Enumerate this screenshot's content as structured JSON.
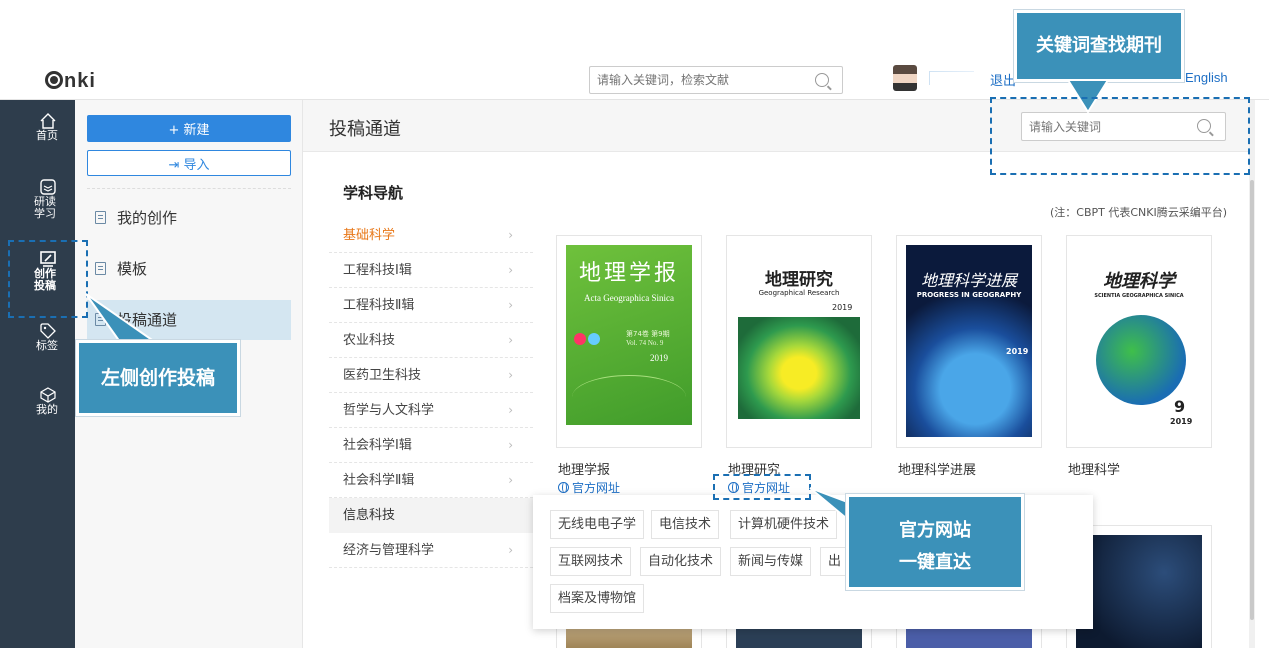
{
  "header": {
    "logo": "nki",
    "search_placeholder": "请输入关键词，检索文献",
    "logout": "退出",
    "language": "English"
  },
  "iconnav": [
    {
      "label": "首页",
      "icon": "home-icon"
    },
    {
      "label": "研读学习",
      "icon": "layers-icon"
    },
    {
      "label": "创作投稿",
      "icon": "edit-screen-icon"
    },
    {
      "label": "标签",
      "icon": "tag-icon"
    },
    {
      "label": "我的",
      "icon": "cube-icon"
    }
  ],
  "subside": {
    "new_button": "+ 新建",
    "import_button": "导入",
    "items": [
      "我的创作",
      "模板",
      "投稿通道"
    ]
  },
  "main": {
    "title": "投稿通道",
    "keyword_placeholder": "请输入关键词",
    "note": "(注：CBPT 代表CNKI腾云采编平台)",
    "nav_heading": "学科导航",
    "categories": [
      "基础科学",
      "工程科技Ⅰ辑",
      "工程科技Ⅱ辑",
      "农业科技",
      "医药卫生科技",
      "哲学与人文科学",
      "社会科学Ⅰ辑",
      "社会科学Ⅱ辑",
      "信息科技",
      "经济与管理科学"
    ],
    "journals": [
      {
        "name": "地理学报",
        "site": "官方网址",
        "cover_title": "地理学报",
        "cover_sub": "Acta Geographica Sinica",
        "cover_vol": "第74卷 第9期",
        "cover_vol2": "Vol. 74  No. 9",
        "cover_year": "2019"
      },
      {
        "name": "地理研究",
        "site": "官方网址",
        "cover_title": "地理研究",
        "cover_sub": "Geographical Research",
        "cover_year": "2019"
      },
      {
        "name": "地理科学进展",
        "cover_title": "地理科学进展",
        "cover_sub": "PROGRESS IN GEOGRAPHY",
        "cover_year": "2019"
      },
      {
        "name": "地理科学",
        "cover_title": "地理科学",
        "cover_sub": "SCIENTIA GEOGRAPHICA SINICA",
        "cover_num": "9",
        "cover_year": "2019"
      }
    ],
    "popover_tags": [
      "无线电电子学",
      "电信技术",
      "计算机硬件技术",
      "互联网技术",
      "自动化技术",
      "新闻与传媒",
      "出",
      "档案及博物馆"
    ]
  },
  "annotations": {
    "left": "左侧创作投稿",
    "top_right": "关键词查找期刊",
    "bottom_line1": "官方网站",
    "bottom_line2": "一键直达"
  },
  "colors": {
    "nav_bg": "#2e3d4c",
    "accent": "#2f87df",
    "category_active": "#e87819",
    "callout": "#3b91b9",
    "dash": "#1a6fb3"
  }
}
